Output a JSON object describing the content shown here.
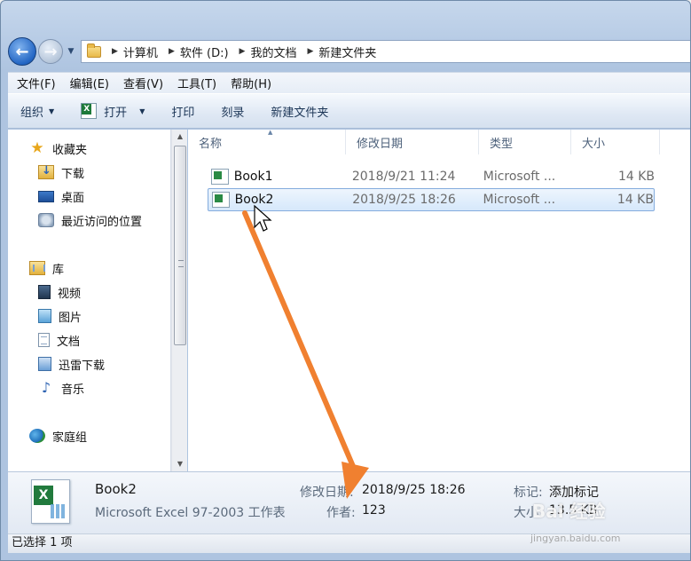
{
  "address": {
    "crumbs": [
      "计算机",
      "软件 (D:)",
      "我的文档",
      "新建文件夹"
    ]
  },
  "menu": [
    "文件(F)",
    "编辑(E)",
    "查看(V)",
    "工具(T)",
    "帮助(H)"
  ],
  "commands": {
    "organize": "组织",
    "open": "打开",
    "print": "打印",
    "burn": "刻录",
    "new_folder": "新建文件夹"
  },
  "nav": {
    "favorites": "收藏夹",
    "downloads": "下载",
    "desktop": "桌面",
    "recent": "最近访问的位置",
    "libraries": "库",
    "video": "视频",
    "pictures": "图片",
    "documents": "文档",
    "thunder": "迅雷下载",
    "music": "音乐",
    "homegroup": "家庭组"
  },
  "columns": {
    "name": "名称",
    "modified": "修改日期",
    "type": "类型",
    "size": "大小"
  },
  "files": [
    {
      "name": "Book1",
      "modified": "2018/9/21 11:24",
      "type": "Microsoft ...",
      "size": "14 KB"
    },
    {
      "name": "Book2",
      "modified": "2018/9/25 18:26",
      "type": "Microsoft ...",
      "size": "14 KB"
    }
  ],
  "details": {
    "name": "Book2",
    "type": "Microsoft Excel 97-2003 工作表",
    "modified_label": "修改日期:",
    "modified_value": "2018/9/25 18:26",
    "author_label": "作者:",
    "author_value": "123",
    "tags_label": "标记:",
    "tags_value": "添加标记",
    "size_label": "大小:",
    "size_value": "13.5 KB"
  },
  "status": "已选择 1 项",
  "watermark": {
    "brand": "Bai 经验",
    "url": "jingyan.baidu.com"
  },
  "colors": {
    "selection_border": "#84acdd",
    "arrow": "#f08030"
  }
}
